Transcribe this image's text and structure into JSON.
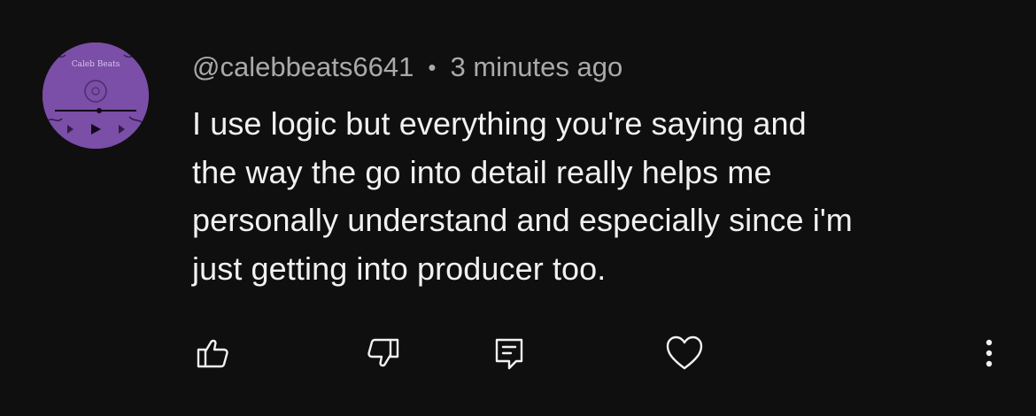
{
  "comment": {
    "avatar_text": "Caleb Beats",
    "author": "@calebbeats6641",
    "separator": "•",
    "timestamp": "3 minutes ago",
    "lines": [
      "I use logic but everything you're saying and",
      "the way the go into detail really helps me",
      "personally understand and especially since i'm",
      "just getting into producer too."
    ]
  },
  "actions": {
    "like_icon": "thumbs-up-icon",
    "dislike_icon": "thumbs-down-icon",
    "reply_icon": "comment-reply-icon",
    "heart_icon": "heart-icon",
    "more_icon": "more-vertical-icon"
  },
  "colors": {
    "background": "#0f0f0f",
    "text_primary": "#f1f1f1",
    "text_secondary": "#aaaaaa",
    "avatar": "#7b4ea8"
  }
}
